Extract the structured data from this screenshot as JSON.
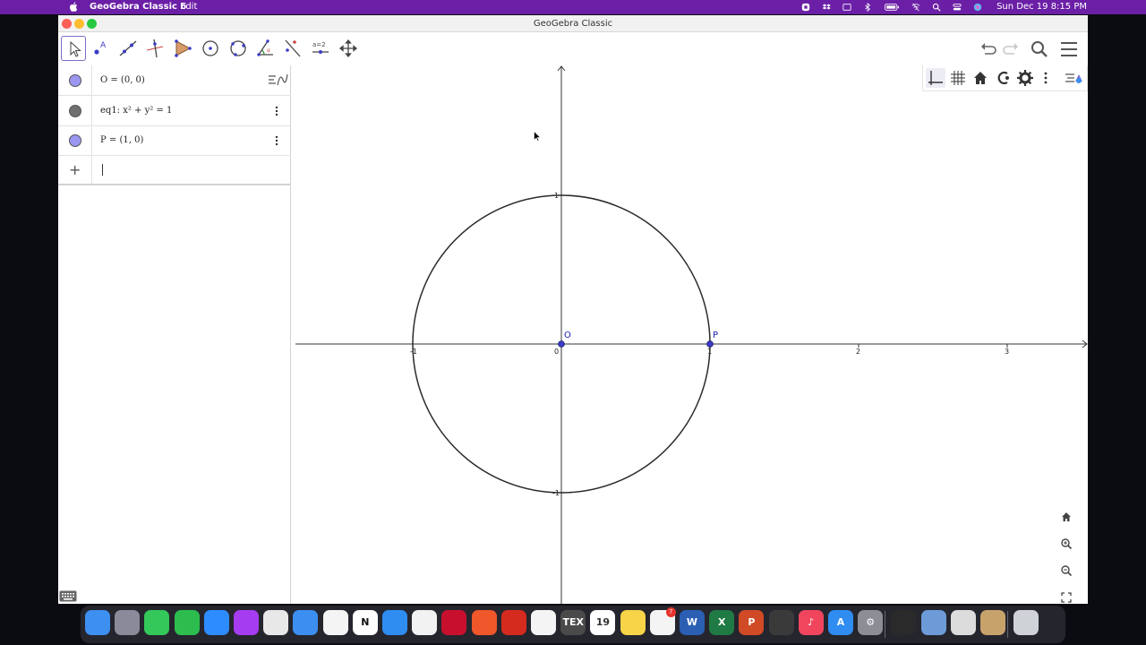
{
  "menubar": {
    "app_name": "GeoGebra Classic 6",
    "menu_edit": "Edit",
    "clock": "Sun Dec 19  8:15 PM",
    "status_icons": [
      "record-icon",
      "dropbox-icon",
      "screen-icon",
      "bluetooth-icon",
      "battery-icon",
      "wifi-off-icon",
      "spotlight-icon",
      "control-center-icon",
      "siri-icon"
    ]
  },
  "window": {
    "title": "GeoGebra Classic"
  },
  "toolbar": {
    "tools": [
      "move-tool",
      "point-tool",
      "line-tool",
      "perpendicular-line-tool",
      "polygon-tool",
      "circle-center-point-tool",
      "circle-three-points-tool",
      "angle-tool",
      "reflect-tool",
      "slider-tool",
      "move-graphics-view-tool"
    ],
    "slider_label": "a=2",
    "right": [
      "undo-icon",
      "redo-icon",
      "search-icon",
      "menu-icon"
    ]
  },
  "algebra": {
    "rows": [
      {
        "expr": "O = (0, 0)",
        "color": "#9b96f0"
      },
      {
        "expr": "eq1: x² + y² = 1",
        "color": "#6f6f6f"
      },
      {
        "expr": "P = (1, 0)",
        "color": "#9b96f0"
      }
    ],
    "input_value": ""
  },
  "graphics": {
    "x_ticks": [
      "-1",
      "0",
      "1",
      "2",
      "3"
    ],
    "y_ticks": [
      "1",
      "-1"
    ],
    "points": [
      {
        "label": "O",
        "x": 0,
        "y": 0
      },
      {
        "label": "P",
        "x": 1,
        "y": 0
      }
    ],
    "circle": {
      "cx": 0,
      "cy": 0,
      "r": 1
    },
    "point_color": "#3c3cc8",
    "label_color": "#2020b0",
    "style_bar": [
      "axes-icon",
      "grid-icon",
      "home-icon",
      "point-capture-icon",
      "gear-icon",
      "more-icon",
      "style-bar-toggle-icon"
    ],
    "zoom_controls": [
      "home-icon",
      "zoom-in-icon",
      "zoom-out-icon",
      "fullscreen-icon"
    ]
  },
  "dock": {
    "apps": [
      {
        "name": "finder",
        "color": "#3d8ff0",
        "glyph": ""
      },
      {
        "name": "launchpad",
        "color": "#8a8a9a",
        "glyph": ""
      },
      {
        "name": "messages",
        "color": "#34c759",
        "glyph": ""
      },
      {
        "name": "facetime",
        "color": "#2dbd4e",
        "glyph": ""
      },
      {
        "name": "zoom",
        "color": "#2d8cff",
        "glyph": ""
      },
      {
        "name": "messenger",
        "color": "#a63cf0",
        "glyph": ""
      },
      {
        "name": "slack",
        "color": "#e8e8e8",
        "glyph": ""
      },
      {
        "name": "mail",
        "color": "#3c8ef0",
        "glyph": ""
      },
      {
        "name": "photos",
        "color": "#f4f4f4",
        "glyph": ""
      },
      {
        "name": "notion",
        "color": "#ffffff",
        "glyph": "N"
      },
      {
        "name": "safari",
        "color": "#2f8cf0",
        "glyph": ""
      },
      {
        "name": "chrome",
        "color": "#f2f2f2",
        "glyph": ""
      },
      {
        "name": "mendeley",
        "color": "#c8102e",
        "glyph": ""
      },
      {
        "name": "brave",
        "color": "#f0572a",
        "glyph": ""
      },
      {
        "name": "gear-app",
        "color": "#d52b1e",
        "glyph": ""
      },
      {
        "name": "geogebra-classic",
        "color": "#f4f4f4",
        "glyph": ""
      },
      {
        "name": "texmaker",
        "color": "#4a4a4a",
        "glyph": "TEX"
      },
      {
        "name": "calendar",
        "color": "#ffffff",
        "glyph": "19"
      },
      {
        "name": "notes",
        "color": "#f7d448",
        "glyph": ""
      },
      {
        "name": "reminders",
        "color": "#f4f4f4",
        "glyph": "",
        "badge": "7"
      },
      {
        "name": "word",
        "color": "#2b5fb4",
        "glyph": "W"
      },
      {
        "name": "excel",
        "color": "#1f7a43",
        "glyph": "X"
      },
      {
        "name": "powerpoint",
        "color": "#d04a25",
        "glyph": "P"
      },
      {
        "name": "quicktime",
        "color": "#3a3a3a",
        "glyph": ""
      },
      {
        "name": "music",
        "color": "#f0455c",
        "glyph": "♪"
      },
      {
        "name": "app-store",
        "color": "#2f8cf0",
        "glyph": "A"
      },
      {
        "name": "system-preferences",
        "color": "#8d8d95",
        "glyph": "⚙"
      },
      {
        "name": "blender",
        "color": "#2a2a2a",
        "glyph": ""
      },
      {
        "name": "preview",
        "color": "#6c9bd8",
        "glyph": ""
      },
      {
        "name": "scanner",
        "color": "#dcdcdc",
        "glyph": ""
      },
      {
        "name": "photo-stack",
        "color": "#c7a26b",
        "glyph": ""
      },
      {
        "name": "trash",
        "color": "#cfd3d8",
        "glyph": ""
      }
    ]
  }
}
